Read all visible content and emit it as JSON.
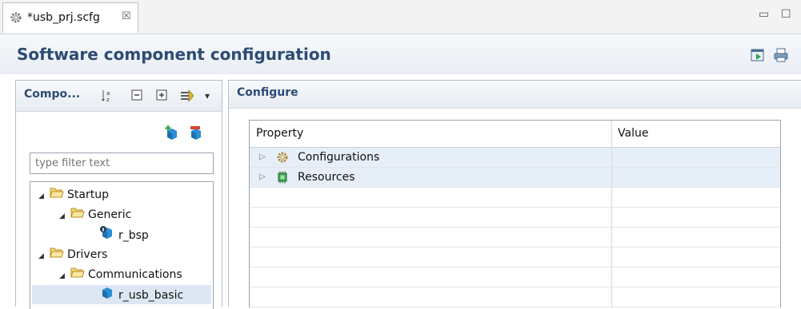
{
  "tab": {
    "title": "*usb_prj.scfg",
    "close": "☒"
  },
  "window": {
    "minimize": "▭",
    "maximize": "☐"
  },
  "header": {
    "title": "Software component configuration"
  },
  "components_panel": {
    "title": "Compo...",
    "filter_placeholder": "type filter text",
    "tree": [
      {
        "label": "Startup",
        "level": 0,
        "type": "folder",
        "expanded": true
      },
      {
        "label": "Generic",
        "level": 1,
        "type": "folder",
        "expanded": true
      },
      {
        "label": "r_bsp",
        "level": 2,
        "type": "component"
      },
      {
        "label": "Drivers",
        "level": 0,
        "type": "folder",
        "expanded": true
      },
      {
        "label": "Communications",
        "level": 1,
        "type": "folder",
        "expanded": true
      },
      {
        "label": "r_usb_basic",
        "level": 2,
        "type": "component",
        "selected": true
      }
    ]
  },
  "configure_panel": {
    "title": "Configure",
    "columns": [
      "Property",
      "Value"
    ],
    "rows": [
      {
        "property": "Configurations",
        "value": "",
        "icon": "gear-icon"
      },
      {
        "property": "Resources",
        "value": "",
        "icon": "chip-icon"
      }
    ]
  },
  "colors": {
    "title_blue": "#2d4b73",
    "selection": "#dde7f3",
    "row_alt": "#e6eef8"
  }
}
